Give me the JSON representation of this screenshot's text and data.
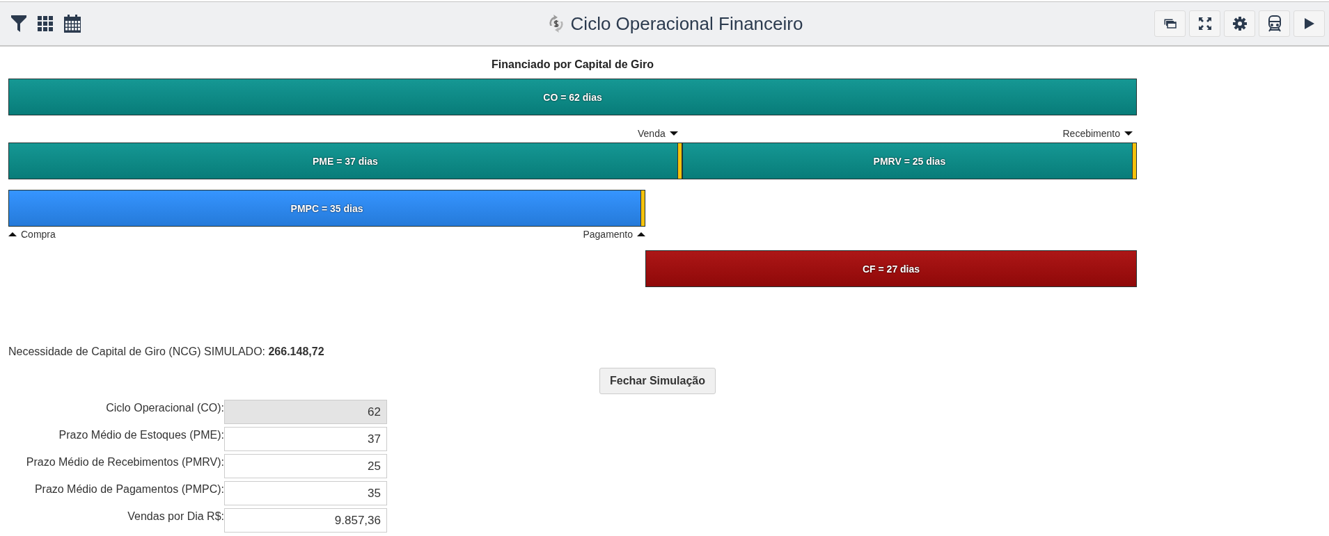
{
  "toolbar": {
    "title": "Ciclo Operacional Financeiro"
  },
  "chart": {
    "title": "Financiado por Capital de Giro",
    "rows": [
      {
        "segments": [
          {
            "kind": "bar",
            "label": "CO = 62 dias",
            "level": 1,
            "color": "#09928e",
            "end_marker": false
          }
        ]
      },
      {
        "segments": [
          {
            "kind": "bar",
            "label": "PME = 37 dias",
            "level": 0.597,
            "color": "#09928e",
            "end_marker": true,
            "marker_above": "Venda"
          },
          {
            "kind": "end_bar",
            "label": "PMRV = 25 dias",
            "level": 0.403,
            "color": "#09928e",
            "end_marker": true,
            "marker_above": "Recebimento"
          }
        ]
      },
      {
        "segments": [
          {
            "kind": "bar",
            "label": "PMPC = 35 dias",
            "level": 0.5645,
            "color": "#2b8fff",
            "end_marker": true,
            "start_below": "Compra",
            "end_below": "Pagamento"
          }
        ]
      },
      {
        "segments": [
          {
            "kind": "end_bar",
            "label": "CF = 27 dias",
            "level": 0.4355,
            "color": "#a80a0a",
            "end_marker": false
          }
        ]
      }
    ]
  },
  "ncg": {
    "label": "Necessidade de Capital de Giro (NCG) SIMULADO:",
    "value": "266.148,72"
  },
  "close_button": "Fechar Simulação",
  "fields": [
    {
      "label": "Ciclo Operacional (CO):",
      "value": "62",
      "disabled": true
    },
    {
      "label": "Prazo Médio de Estoques (PME):",
      "value": "37",
      "disabled": false
    },
    {
      "label": "Prazo Médio de Recebimentos (PMRV):",
      "value": "25",
      "disabled": false
    },
    {
      "label": "Prazo Médio de Pagamentos (PMPC):",
      "value": "35",
      "disabled": false
    },
    {
      "label": "Vendas por Dia R$:",
      "value": "9.857,36",
      "disabled": false
    }
  ]
}
